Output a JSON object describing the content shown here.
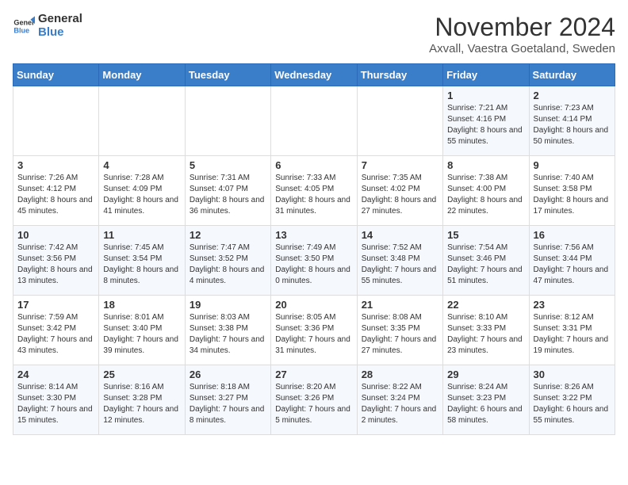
{
  "header": {
    "logo_general": "General",
    "logo_blue": "Blue",
    "month_title": "November 2024",
    "location": "Axvall, Vaestra Goetaland, Sweden"
  },
  "days_of_week": [
    "Sunday",
    "Monday",
    "Tuesday",
    "Wednesday",
    "Thursday",
    "Friday",
    "Saturday"
  ],
  "weeks": [
    [
      {
        "day": "",
        "info": ""
      },
      {
        "day": "",
        "info": ""
      },
      {
        "day": "",
        "info": ""
      },
      {
        "day": "",
        "info": ""
      },
      {
        "day": "",
        "info": ""
      },
      {
        "day": "1",
        "info": "Sunrise: 7:21 AM\nSunset: 4:16 PM\nDaylight: 8 hours and 55 minutes."
      },
      {
        "day": "2",
        "info": "Sunrise: 7:23 AM\nSunset: 4:14 PM\nDaylight: 8 hours and 50 minutes."
      }
    ],
    [
      {
        "day": "3",
        "info": "Sunrise: 7:26 AM\nSunset: 4:12 PM\nDaylight: 8 hours and 45 minutes."
      },
      {
        "day": "4",
        "info": "Sunrise: 7:28 AM\nSunset: 4:09 PM\nDaylight: 8 hours and 41 minutes."
      },
      {
        "day": "5",
        "info": "Sunrise: 7:31 AM\nSunset: 4:07 PM\nDaylight: 8 hours and 36 minutes."
      },
      {
        "day": "6",
        "info": "Sunrise: 7:33 AM\nSunset: 4:05 PM\nDaylight: 8 hours and 31 minutes."
      },
      {
        "day": "7",
        "info": "Sunrise: 7:35 AM\nSunset: 4:02 PM\nDaylight: 8 hours and 27 minutes."
      },
      {
        "day": "8",
        "info": "Sunrise: 7:38 AM\nSunset: 4:00 PM\nDaylight: 8 hours and 22 minutes."
      },
      {
        "day": "9",
        "info": "Sunrise: 7:40 AM\nSunset: 3:58 PM\nDaylight: 8 hours and 17 minutes."
      }
    ],
    [
      {
        "day": "10",
        "info": "Sunrise: 7:42 AM\nSunset: 3:56 PM\nDaylight: 8 hours and 13 minutes."
      },
      {
        "day": "11",
        "info": "Sunrise: 7:45 AM\nSunset: 3:54 PM\nDaylight: 8 hours and 8 minutes."
      },
      {
        "day": "12",
        "info": "Sunrise: 7:47 AM\nSunset: 3:52 PM\nDaylight: 8 hours and 4 minutes."
      },
      {
        "day": "13",
        "info": "Sunrise: 7:49 AM\nSunset: 3:50 PM\nDaylight: 8 hours and 0 minutes."
      },
      {
        "day": "14",
        "info": "Sunrise: 7:52 AM\nSunset: 3:48 PM\nDaylight: 7 hours and 55 minutes."
      },
      {
        "day": "15",
        "info": "Sunrise: 7:54 AM\nSunset: 3:46 PM\nDaylight: 7 hours and 51 minutes."
      },
      {
        "day": "16",
        "info": "Sunrise: 7:56 AM\nSunset: 3:44 PM\nDaylight: 7 hours and 47 minutes."
      }
    ],
    [
      {
        "day": "17",
        "info": "Sunrise: 7:59 AM\nSunset: 3:42 PM\nDaylight: 7 hours and 43 minutes."
      },
      {
        "day": "18",
        "info": "Sunrise: 8:01 AM\nSunset: 3:40 PM\nDaylight: 7 hours and 39 minutes."
      },
      {
        "day": "19",
        "info": "Sunrise: 8:03 AM\nSunset: 3:38 PM\nDaylight: 7 hours and 34 minutes."
      },
      {
        "day": "20",
        "info": "Sunrise: 8:05 AM\nSunset: 3:36 PM\nDaylight: 7 hours and 31 minutes."
      },
      {
        "day": "21",
        "info": "Sunrise: 8:08 AM\nSunset: 3:35 PM\nDaylight: 7 hours and 27 minutes."
      },
      {
        "day": "22",
        "info": "Sunrise: 8:10 AM\nSunset: 3:33 PM\nDaylight: 7 hours and 23 minutes."
      },
      {
        "day": "23",
        "info": "Sunrise: 8:12 AM\nSunset: 3:31 PM\nDaylight: 7 hours and 19 minutes."
      }
    ],
    [
      {
        "day": "24",
        "info": "Sunrise: 8:14 AM\nSunset: 3:30 PM\nDaylight: 7 hours and 15 minutes."
      },
      {
        "day": "25",
        "info": "Sunrise: 8:16 AM\nSunset: 3:28 PM\nDaylight: 7 hours and 12 minutes."
      },
      {
        "day": "26",
        "info": "Sunrise: 8:18 AM\nSunset: 3:27 PM\nDaylight: 7 hours and 8 minutes."
      },
      {
        "day": "27",
        "info": "Sunrise: 8:20 AM\nSunset: 3:26 PM\nDaylight: 7 hours and 5 minutes."
      },
      {
        "day": "28",
        "info": "Sunrise: 8:22 AM\nSunset: 3:24 PM\nDaylight: 7 hours and 2 minutes."
      },
      {
        "day": "29",
        "info": "Sunrise: 8:24 AM\nSunset: 3:23 PM\nDaylight: 6 hours and 58 minutes."
      },
      {
        "day": "30",
        "info": "Sunrise: 8:26 AM\nSunset: 3:22 PM\nDaylight: 6 hours and 55 minutes."
      }
    ]
  ]
}
